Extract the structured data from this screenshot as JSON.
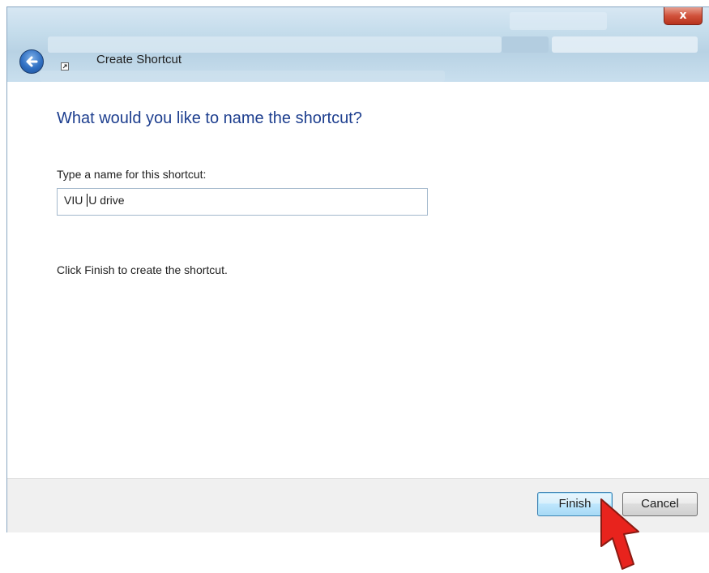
{
  "window": {
    "title": "Create Shortcut",
    "close_glyph": "x"
  },
  "wizard": {
    "heading": "What would you like to name the shortcut?",
    "name_label": "Type a name for this shortcut:",
    "name_value_before_caret": "VIU ",
    "name_value_after_caret": "U drive",
    "instruction": "Click Finish to create the shortcut."
  },
  "footer": {
    "finish_label": "Finish",
    "cancel_label": "Cancel"
  },
  "colors": {
    "heading": "#1e3f8f",
    "annotation_arrow": "#e8231d",
    "close_button": "#c8432b"
  },
  "icons": {
    "back": "back-arrow-icon",
    "shortcut": "shortcut-icon",
    "annotation": "red-pointer-arrow-icon"
  }
}
